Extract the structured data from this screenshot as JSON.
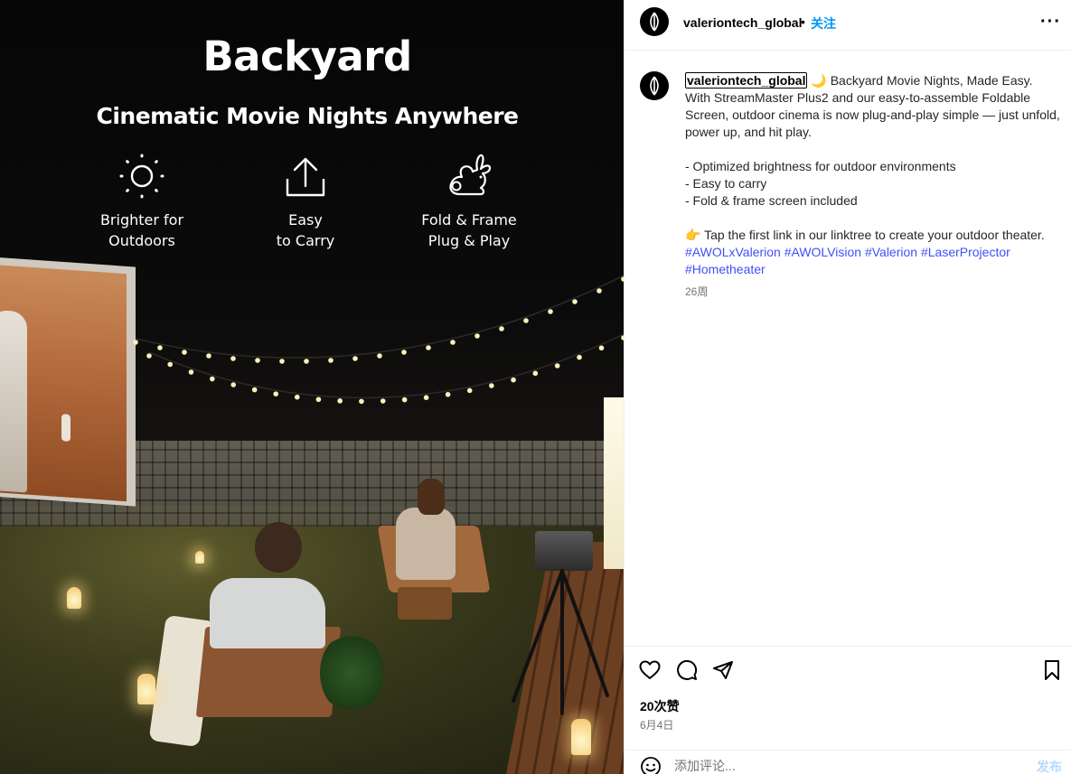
{
  "media": {
    "headline": "Backyard",
    "subheadline": "Cinematic Movie Nights Anywhere",
    "features": [
      {
        "icon": "sun-icon",
        "line1": "Brighter for",
        "line2": "Outdoors"
      },
      {
        "icon": "upload-icon",
        "line1": "Easy",
        "line2": "to Carry"
      },
      {
        "icon": "rabbit-icon",
        "line1": "Fold & Frame",
        "line2": "Plug & Play"
      }
    ]
  },
  "header": {
    "username": "valeriontech_global",
    "separator": "•",
    "follow_label": "关注",
    "more_label": "···"
  },
  "caption": {
    "username": "valeriontech_global",
    "lines": [
      "🌙 Backyard Movie Nights, Made Easy.",
      "With StreamMaster Plus2 and our easy-to-assemble Foldable",
      "Screen, outdoor cinema is now plug-and-play simple — just unfold,",
      "power up, and hit play.",
      "- Optimized brightness for outdoor environments",
      "- Easy to carry",
      "- Fold & frame screen included",
      "👉 Tap the first link in our linktree to create your outdoor theater."
    ],
    "hashtags": [
      "#AWOLxValerion",
      "#AWOLVision",
      "#Valerion",
      "#LaserProjector",
      "#Hometheater"
    ],
    "age": "26周"
  },
  "actions": {
    "likes": "20次赞",
    "date": "6月4日"
  },
  "comment": {
    "placeholder": "添加评论...",
    "post_label": "发布"
  },
  "colors": {
    "link": "#0095f6",
    "hashtag": "#4150f7",
    "muted": "#737373",
    "post_disabled": "#b3dbff"
  }
}
